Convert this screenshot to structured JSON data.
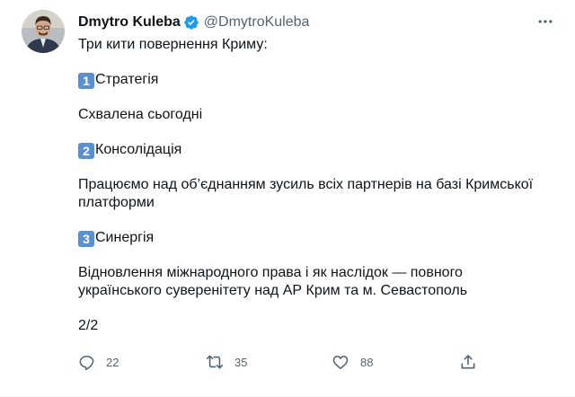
{
  "author": {
    "name": "Dmytro Kuleba",
    "handle": "@DmytroKuleba",
    "verified": true
  },
  "tweet": {
    "lines": [
      "Три кити повернення Криму:",
      "Стратегія",
      "Схвалена сьогодні",
      "Консолідація",
      "Працюємо над об’єднанням зусиль всіх партнерів на базі Кримської платформи",
      "Синергія",
      "Відновлення міжнародного права і як наслідок — повного українського суверенітету над АР Крим та м. Севастополь",
      "2/2"
    ],
    "numbers": [
      "1",
      "2",
      "3"
    ]
  },
  "actions": {
    "reply_count": "22",
    "retweet_count": "35",
    "like_count": "88"
  },
  "icons": {
    "verified": "verified-badge-icon",
    "more": "more-options-icon",
    "reply": "reply-icon",
    "retweet": "retweet-icon",
    "like": "heart-icon",
    "share": "share-icon"
  },
  "colors": {
    "text": "#0f1419",
    "secondary": "#536471",
    "verified": "#1d9bf0",
    "keycap": "#5a8fd0"
  }
}
